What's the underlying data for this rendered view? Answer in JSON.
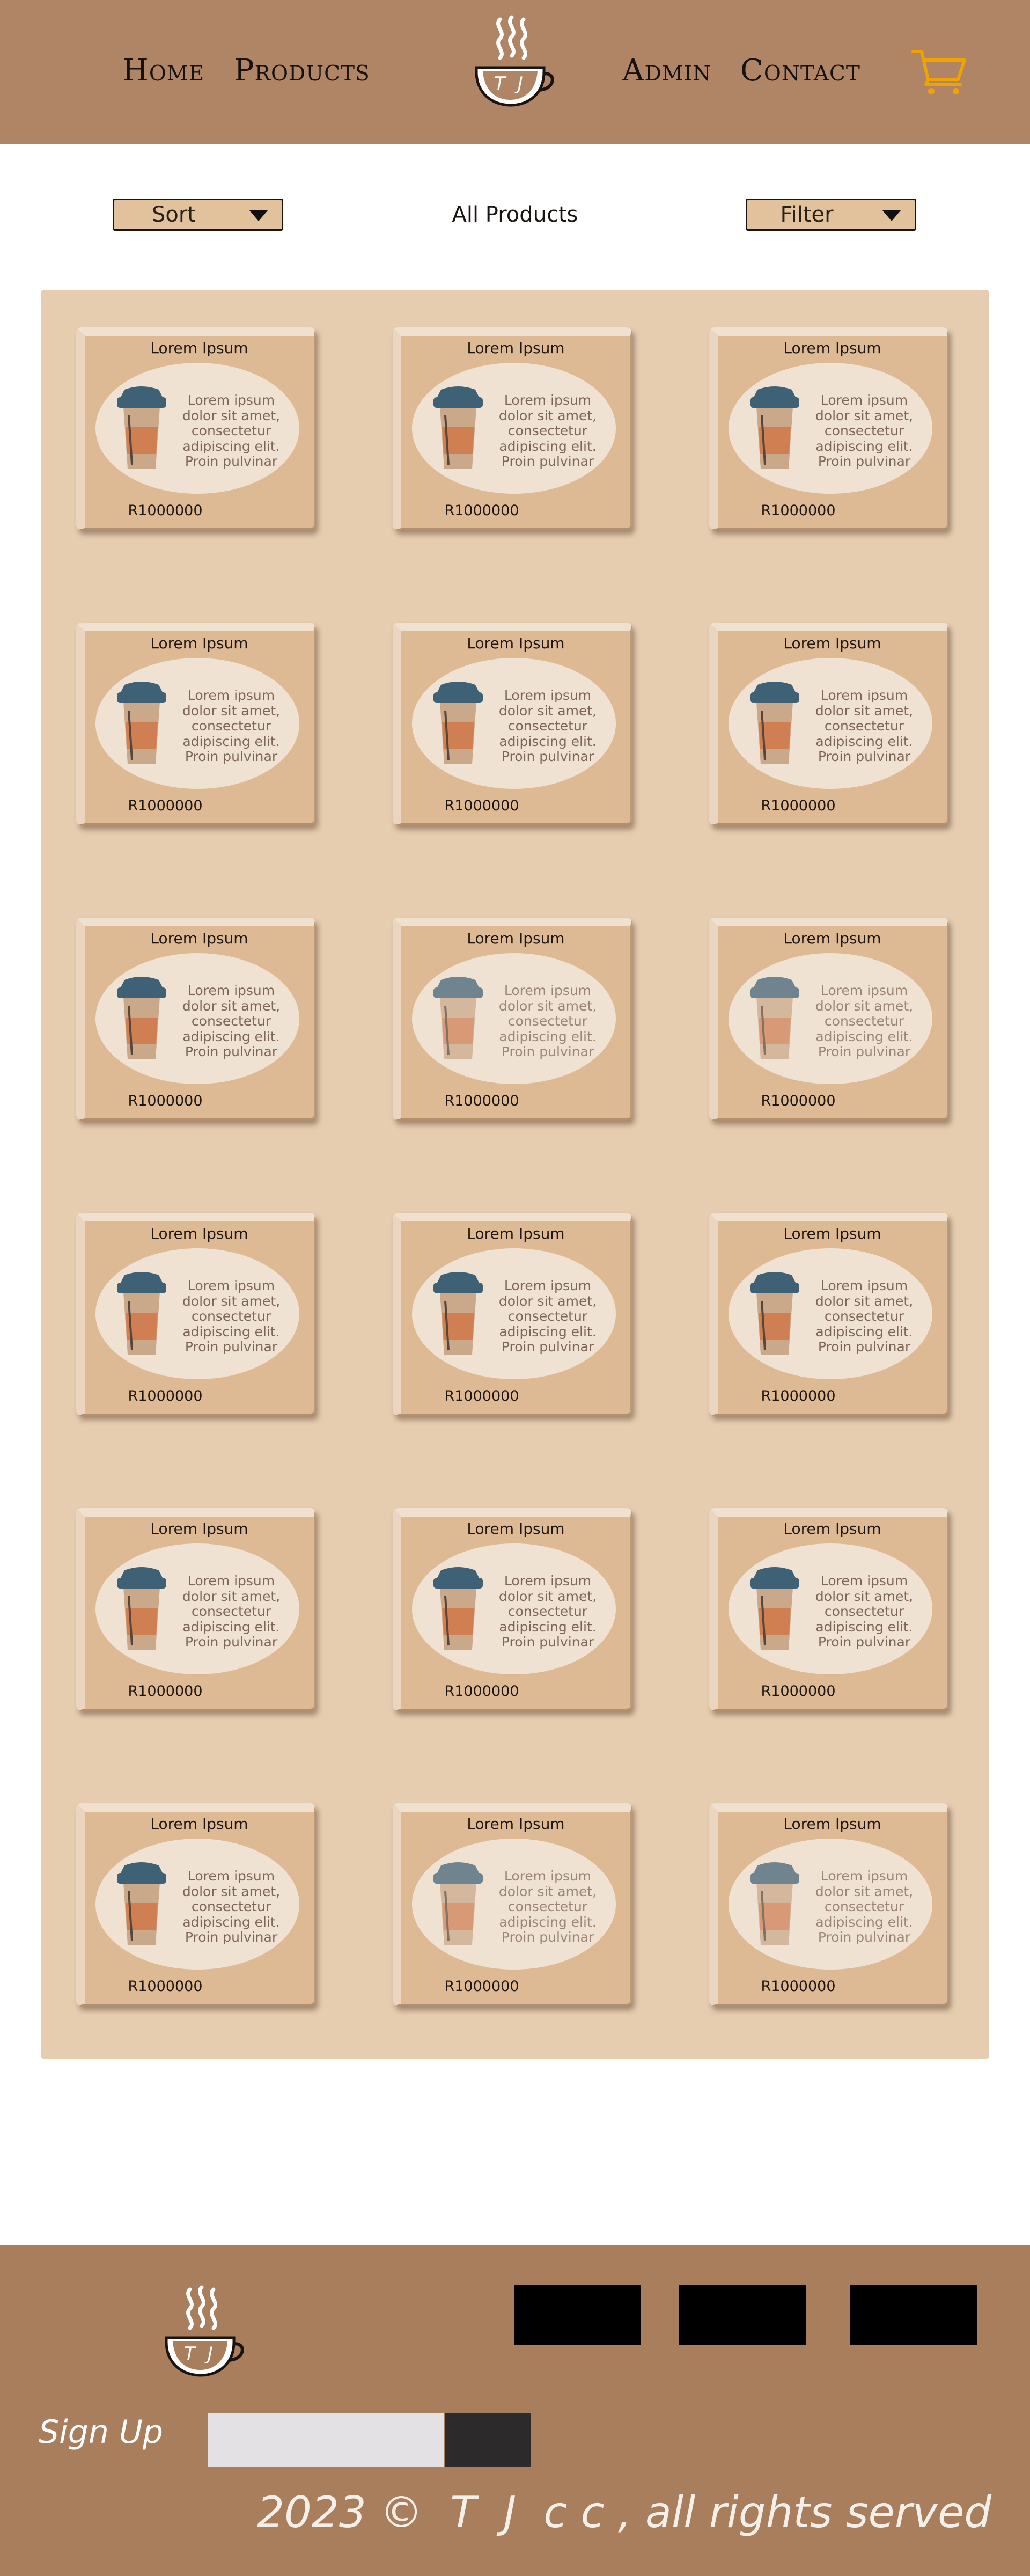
{
  "colors": {
    "header_bg": "#af8566",
    "footer_bg": "#a97e5d",
    "grid_bg": "#e6cdb0",
    "card_bg": "#deba94",
    "cart_icon": "#f0a300",
    "cup_lid": "#3e6176",
    "cup_sleeve": "#d07f53",
    "cup_body": "#caa98b"
  },
  "nav": {
    "home": "Home",
    "products": "Products",
    "admin": "Admin",
    "contact": "Contact",
    "logo_letters": "T J",
    "cart_icon": "shopping-cart-icon"
  },
  "toolbar": {
    "sort_label": "Sort",
    "filter_label": "Filter",
    "page_heading": "All Products"
  },
  "products": [
    {
      "title": "Lorem Ipsum",
      "desc_lines": [
        "Lorem ipsum",
        "dolor sit amet,",
        "consectetur",
        "adipiscing elit.",
        "Proin pulvinar"
      ],
      "price": "R1000000"
    },
    {
      "title": "Lorem Ipsum",
      "desc_lines": [
        "Lorem ipsum",
        "dolor sit amet,",
        "consectetur",
        "adipiscing elit.",
        "Proin pulvinar"
      ],
      "price": "R1000000"
    },
    {
      "title": "Lorem Ipsum",
      "desc_lines": [
        "Lorem ipsum",
        "dolor sit amet,",
        "consectetur",
        "adipiscing elit.",
        "Proin pulvinar"
      ],
      "price": "R1000000"
    },
    {
      "title": "Lorem Ipsum",
      "desc_lines": [
        "Lorem ipsum",
        "dolor sit amet,",
        "consectetur",
        "adipiscing elit.",
        "Proin pulvinar"
      ],
      "price": "R1000000"
    },
    {
      "title": "Lorem Ipsum",
      "desc_lines": [
        "Lorem ipsum",
        "dolor sit amet,",
        "consectetur",
        "adipiscing elit.",
        "Proin pulvinar"
      ],
      "price": "R1000000"
    },
    {
      "title": "Lorem Ipsum",
      "desc_lines": [
        "Lorem ipsum",
        "dolor sit amet,",
        "consectetur",
        "adipiscing elit.",
        "Proin pulvinar"
      ],
      "price": "R1000000"
    },
    {
      "title": "Lorem Ipsum",
      "desc_lines": [
        "Lorem ipsum",
        "dolor sit amet,",
        "consectetur",
        "adipiscing elit.",
        "Proin pulvinar"
      ],
      "price": "R1000000"
    },
    {
      "title": "Lorem Ipsum",
      "desc_lines": [
        "Lorem ipsum",
        "dolor sit amet,",
        "consectetur",
        "adipiscing elit.",
        "Proin pulvinar"
      ],
      "price": "R1000000"
    },
    {
      "title": "Lorem Ipsum",
      "desc_lines": [
        "Lorem ipsum",
        "dolor sit amet,",
        "consectetur",
        "adipiscing elit.",
        "Proin pulvinar"
      ],
      "price": "R1000000"
    },
    {
      "title": "Lorem Ipsum",
      "desc_lines": [
        "Lorem ipsum",
        "dolor sit amet,",
        "consectetur",
        "adipiscing elit.",
        "Proin pulvinar"
      ],
      "price": "R1000000"
    },
    {
      "title": "Lorem Ipsum",
      "desc_lines": [
        "Lorem ipsum",
        "dolor sit amet,",
        "consectetur",
        "adipiscing elit.",
        "Proin pulvinar"
      ],
      "price": "R1000000"
    },
    {
      "title": "Lorem Ipsum",
      "desc_lines": [
        "Lorem ipsum",
        "dolor sit amet,",
        "consectetur",
        "adipiscing elit.",
        "Proin pulvinar"
      ],
      "price": "R1000000"
    },
    {
      "title": "Lorem Ipsum",
      "desc_lines": [
        "Lorem ipsum",
        "dolor sit amet,",
        "consectetur",
        "adipiscing elit.",
        "Proin pulvinar"
      ],
      "price": "R1000000"
    },
    {
      "title": "Lorem Ipsum",
      "desc_lines": [
        "Lorem ipsum",
        "dolor sit amet,",
        "consectetur",
        "adipiscing elit.",
        "Proin pulvinar"
      ],
      "price": "R1000000"
    },
    {
      "title": "Lorem Ipsum",
      "desc_lines": [
        "Lorem ipsum",
        "dolor sit amet,",
        "consectetur",
        "adipiscing elit.",
        "Proin pulvinar"
      ],
      "price": "R1000000"
    },
    {
      "title": "Lorem Ipsum",
      "desc_lines": [
        "Lorem ipsum",
        "dolor sit amet,",
        "consectetur",
        "adipiscing elit.",
        "Proin pulvinar"
      ],
      "price": "R1000000"
    },
    {
      "title": "Lorem Ipsum",
      "desc_lines": [
        "Lorem ipsum",
        "dolor sit amet,",
        "consectetur",
        "adipiscing elit.",
        "Proin pulvinar"
      ],
      "price": "R1000000"
    },
    {
      "title": "Lorem Ipsum",
      "desc_lines": [
        "Lorem ipsum",
        "dolor sit amet,",
        "consectetur",
        "adipiscing elit.",
        "Proin pulvinar"
      ],
      "price": "R1000000"
    }
  ],
  "footer": {
    "logo_letters": "T J",
    "signup_label": "Sign Up",
    "copyright": "2023 ©  T  J  c c , all rights served"
  }
}
